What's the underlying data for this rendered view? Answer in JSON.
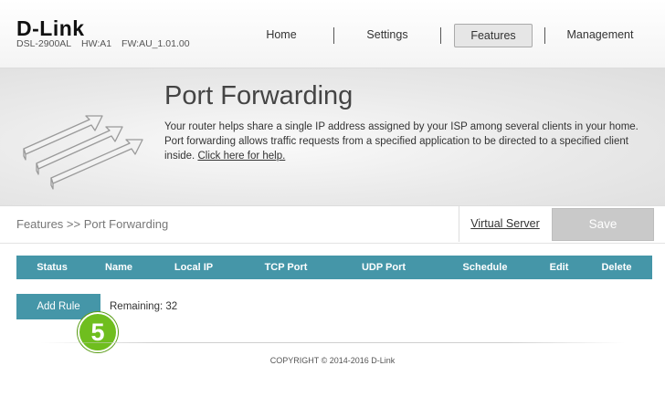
{
  "header": {
    "logo": "D-Link",
    "model": "DSL-2900AL",
    "hw": "HW:A1",
    "fw": "FW:AU_1.01.00"
  },
  "nav": {
    "home": "Home",
    "settings": "Settings",
    "features": "Features",
    "management": "Management"
  },
  "banner": {
    "title": "Port Forwarding",
    "description": "Your router helps share a single IP address assigned by your ISP among several clients in your home. Port forwarding allows traffic requests from a specified application to be directed to a specified client inside.",
    "help_link": "Click here for help."
  },
  "breadcrumb": "Features >> Port Forwarding",
  "actions": {
    "virtual_server": "Virtual Server",
    "save": "Save"
  },
  "table": {
    "columns": [
      "Status",
      "Name",
      "Local IP",
      "TCP Port",
      "UDP Port",
      "Schedule",
      "Edit",
      "Delete"
    ]
  },
  "rules": {
    "add_label": "Add Rule",
    "remaining_label": "Remaining:",
    "remaining_count": "32"
  },
  "annotation": {
    "step": "5"
  },
  "footer": {
    "copyright": "COPYRIGHT © 2014-2016 D-Link"
  },
  "colors": {
    "accent": "#4596a8",
    "badge": "#6fbe1e",
    "save_disabled": "#c9c9c9"
  }
}
